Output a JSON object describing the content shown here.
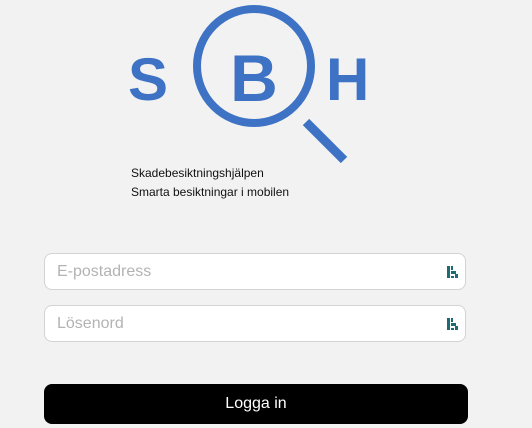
{
  "brand": {
    "logo_letters": [
      "S",
      "B",
      "H"
    ],
    "color": "#3d72c4"
  },
  "tagline": {
    "line1": "Skadebesiktningshjälpen",
    "line2": "Smarta besiktningar i mobilen"
  },
  "form": {
    "email_placeholder": "E-postadress",
    "email_value": "",
    "password_placeholder": "Lösenord",
    "password_value": "",
    "field_icon": "password-manager-icon",
    "field_icon_color": "#1d6b73",
    "submit_label": "Logga in"
  }
}
